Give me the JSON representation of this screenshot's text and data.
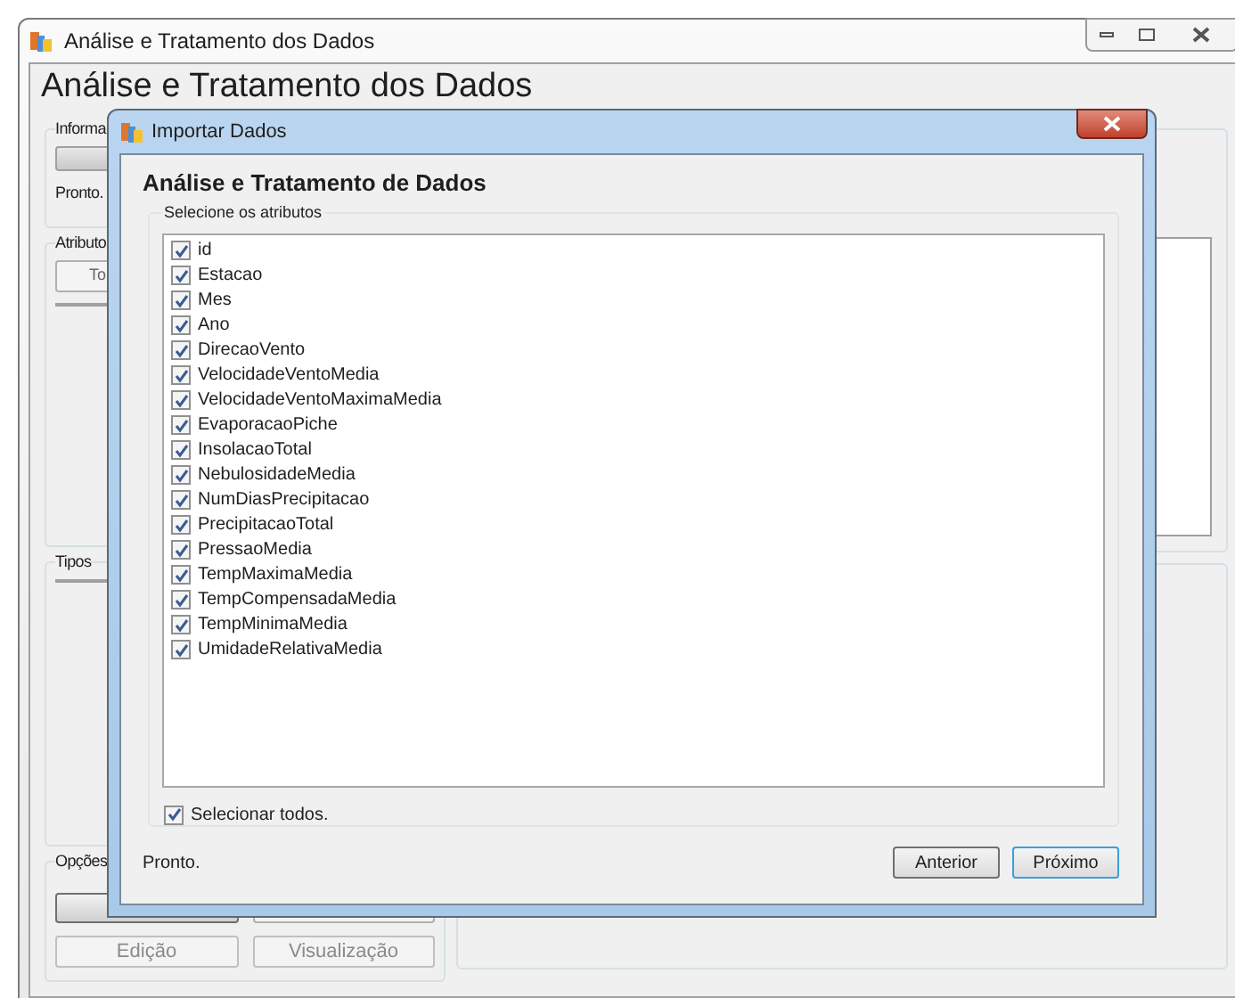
{
  "main_window": {
    "title": "Análise e Tratamento dos Dados",
    "heading": "Análise e Tratamento dos Dados",
    "groups": [
      {
        "kind": "progress",
        "label": "Informa",
        "status": "Pronto."
      },
      {
        "kind": "list",
        "label": "Atributo",
        "button": "To"
      },
      {
        "kind": "list",
        "label": "Tipos"
      },
      {
        "kind": "options",
        "label": "Opções",
        "buttons": [
          {
            "label": "Edição",
            "disabled": true
          },
          {
            "label": "Visualização",
            "disabled": true
          }
        ]
      }
    ]
  },
  "dialog": {
    "title": "Importar Dados",
    "heading": "Análise e Tratamento de Dados",
    "group_label": "Selecione os atributos",
    "attributes": [
      {
        "label": "id",
        "checked": true
      },
      {
        "label": "Estacao",
        "checked": true
      },
      {
        "label": "Mes",
        "checked": true
      },
      {
        "label": "Ano",
        "checked": true
      },
      {
        "label": "DirecaoVento",
        "checked": true
      },
      {
        "label": "VelocidadeVentoMedia",
        "checked": true
      },
      {
        "label": "VelocidadeVentoMaximaMedia",
        "checked": true
      },
      {
        "label": "EvaporacaoPiche",
        "checked": true
      },
      {
        "label": "InsolacaoTotal",
        "checked": true
      },
      {
        "label": "NebulosidadeMedia",
        "checked": true
      },
      {
        "label": "NumDiasPrecipitacao",
        "checked": true
      },
      {
        "label": "PrecipitacaoTotal",
        "checked": true
      },
      {
        "label": "PressaoMedia",
        "checked": true
      },
      {
        "label": "TempMaximaMedia",
        "checked": true
      },
      {
        "label": "TempCompensadaMedia",
        "checked": true
      },
      {
        "label": "TempMinimaMedia",
        "checked": true
      },
      {
        "label": "UmidadeRelativaMedia",
        "checked": true
      }
    ],
    "select_all": {
      "label": "Selecionar todos.",
      "checked": true
    },
    "status": "Pronto.",
    "buttons": [
      {
        "label": "Anterior",
        "default": false
      },
      {
        "label": "Próximo",
        "default": true
      }
    ]
  }
}
